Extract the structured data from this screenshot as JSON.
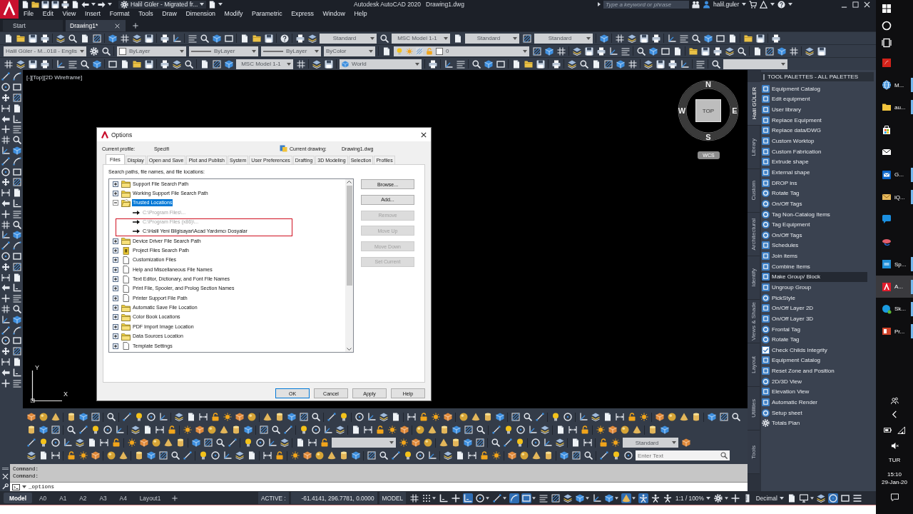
{
  "app_bar": {
    "workspace": "Halil Güler - Migrated fr...",
    "app_name": "Autodesk AutoCAD 2020",
    "file_name": "Drawing1.dwg",
    "search": {
      "placeholder": "Type a keyword or phrase"
    },
    "user": "halil.guler"
  },
  "menu": [
    "File",
    "Edit",
    "View",
    "Insert",
    "Format",
    "Tools",
    "Draw",
    "Dimension",
    "Modify",
    "Parametric",
    "Express",
    "Window",
    "Help"
  ],
  "doc_tabs": [
    {
      "label": "Start",
      "selected": false
    },
    {
      "label": "Drawing1*",
      "selected": true
    }
  ],
  "toolbars": {
    "row_1": {
      "dropdowns": [
        {
          "value": "Standard"
        },
        {
          "value": "MSC Model 1-1"
        },
        {
          "value": "Standard"
        },
        {
          "value": "Standard"
        }
      ]
    },
    "row_2": {
      "dropdowns": [
        {
          "value": "Halil Güler - M...018 - Englis"
        },
        {
          "value": "ByLayer"
        },
        {
          "value": "ByLayer"
        },
        {
          "value": "ByLayer"
        },
        {
          "value": "ByColor"
        },
        {
          "value": "0"
        }
      ]
    },
    "row_3": {
      "dropdowns": [
        {
          "value": "MSC Model 1-1"
        },
        {
          "value": "World"
        }
      ]
    },
    "bottom_row_3": {
      "dropdowns": [
        {
          "value": "Standard"
        }
      ]
    },
    "bottom_row_4": {
      "search": {
        "placeholder": "Enter Text"
      }
    }
  },
  "viewport": {
    "label": "[-][Top][2D Wireframe]",
    "viewcube": {
      "north": "N",
      "east": "E",
      "south": "S",
      "west": "W",
      "face": "TOP",
      "ucs": "WCS"
    },
    "ucs_icon": {
      "y_axis": "Y",
      "x_axis": "X"
    }
  },
  "options_dialog": {
    "title": "Options",
    "profile_label": "Current profile:",
    "profile": "Specifi",
    "drawing_label": "Current drawing:",
    "drawing": "Drawing1.dwg",
    "tabs": [
      {
        "label": "Files",
        "selected": true
      },
      {
        "label": "Display",
        "selected": false
      },
      {
        "label": "Open and Save",
        "selected": false
      },
      {
        "label": "Plot and Publish",
        "selected": false
      },
      {
        "label": "System",
        "selected": false
      },
      {
        "label": "User Preferences",
        "selected": false
      },
      {
        "label": "Drafting",
        "selected": false
      },
      {
        "label": "3D Modeling",
        "selected": false
      },
      {
        "label": "Selection",
        "selected": false
      },
      {
        "label": "Profiles",
        "selected": false
      }
    ],
    "list_label": "Search paths, file names, and file locations:",
    "tree": [
      {
        "label": "Support File Search Path",
        "kind": "folder",
        "expanded": false,
        "selected": false
      },
      {
        "label": "Working Support File Search Path",
        "kind": "folder",
        "expanded": false,
        "selected": false
      },
      {
        "label": "Trusted Locations",
        "kind": "folder",
        "expanded": true,
        "selected": true,
        "children": [
          {
            "label": "C:\\Program Files\\...",
            "disabled": true,
            "selected": false
          },
          {
            "label": "C:\\Program Files (x86)\\...",
            "disabled": true,
            "selected": false
          },
          {
            "label": "C:\\Halil Yeni Bilgisayar\\Acad Yardımcı Dosyalar",
            "disabled": false,
            "selected": false
          }
        ]
      },
      {
        "label": "Device Driver File Search Path",
        "kind": "folder",
        "expanded": false,
        "selected": false
      },
      {
        "label": "Project Files Search Path",
        "kind": "project",
        "expanded": false,
        "selected": false
      },
      {
        "label": "Customization Files",
        "kind": "file",
        "expanded": false,
        "selected": false
      },
      {
        "label": "Help and Miscellaneous File Names",
        "kind": "file",
        "expanded": false,
        "selected": false
      },
      {
        "label": "Text Editor, Dictionary, and Font File Names",
        "kind": "file",
        "expanded": false,
        "selected": false
      },
      {
        "label": "Print File, Spooler, and Prolog Section Names",
        "kind": "file",
        "expanded": false,
        "selected": false
      },
      {
        "label": "Printer Support File Path",
        "kind": "file",
        "expanded": false,
        "selected": false
      },
      {
        "label": "Automatic Save File Location",
        "kind": "folder",
        "expanded": false,
        "selected": false
      },
      {
        "label": "Color Book Locations",
        "kind": "folder",
        "expanded": false,
        "selected": false
      },
      {
        "label": "PDF Import Image Location",
        "kind": "folder",
        "expanded": false,
        "selected": false
      },
      {
        "label": "Data Sources Location",
        "kind": "folder",
        "expanded": false,
        "selected": false
      },
      {
        "label": "Template Settings",
        "kind": "file",
        "expanded": false,
        "selected": false
      }
    ],
    "side_buttons": [
      {
        "label": "Browse...",
        "disabled": false
      },
      {
        "label": "Add...",
        "disabled": false
      },
      {
        "label": "Remove",
        "disabled": true
      },
      {
        "label": "Move Up",
        "disabled": true
      },
      {
        "label": "Move Down",
        "disabled": true
      },
      {
        "label": "Set Current",
        "disabled": true
      }
    ],
    "footer_buttons": [
      {
        "label": "OK",
        "default": true
      },
      {
        "label": "Cancel",
        "default": false
      },
      {
        "label": "Apply",
        "default": false
      },
      {
        "label": "Help",
        "default": false
      }
    ]
  },
  "tool_palette": {
    "title": "TOOL PALETTES - ALL PALETTES",
    "tabs": [
      {
        "label": "Halil GÜLER",
        "selected": true
      },
      {
        "label": "Library",
        "selected": false
      },
      {
        "label": "Custom",
        "selected": false
      },
      {
        "label": "Architectural",
        "selected": false
      },
      {
        "label": "Identify",
        "selected": false
      },
      {
        "label": "Views & Shade",
        "selected": false
      },
      {
        "label": "Layout",
        "selected": false
      },
      {
        "label": "Utilities",
        "selected": false
      },
      {
        "label": "Tools",
        "selected": false
      }
    ],
    "items": [
      {
        "label": "Equipment Catalog",
        "selected": false
      },
      {
        "label": "Edit equipment",
        "selected": false
      },
      {
        "label": "User library",
        "selected": false
      },
      {
        "label": "Replace Equipment",
        "selected": false
      },
      {
        "label": "Replace data/DWG",
        "selected": false
      },
      {
        "label": "Custom Worktop",
        "selected": false
      },
      {
        "label": "Custom Fabrication",
        "selected": false
      },
      {
        "label": "Extrude shape",
        "selected": false
      },
      {
        "label": "External shape",
        "selected": false
      },
      {
        "label": "DROP ins",
        "selected": false
      },
      {
        "label": "Rotate Tag",
        "selected": false
      },
      {
        "label": "On/Off Tags",
        "selected": false
      },
      {
        "label": "Tag Non-Catalog Items",
        "selected": false
      },
      {
        "label": "Tag Equipment",
        "selected": false
      },
      {
        "label": "On/Off Tags",
        "selected": false
      },
      {
        "label": "Schedules",
        "selected": false
      },
      {
        "label": "Join items",
        "selected": false
      },
      {
        "label": "Combine Items",
        "selected": false
      },
      {
        "label": "Make Group/ Block",
        "selected": true
      },
      {
        "label": "Ungroup Group",
        "selected": false
      },
      {
        "label": "PickStyle",
        "selected": false
      },
      {
        "label": "On/Off Layer 2D",
        "selected": false
      },
      {
        "label": "On/Off Layer 3D",
        "selected": false
      },
      {
        "label": "Frontal Tag",
        "selected": false
      },
      {
        "label": "Rotate Tag",
        "selected": false
      },
      {
        "label": "Check Childs Integrity",
        "selected": false
      },
      {
        "label": "Equipment Catalog",
        "selected": false
      },
      {
        "label": "Reset Zone and Position",
        "selected": false
      },
      {
        "label": "2D/3D View",
        "selected": false
      },
      {
        "label": "Elevation View",
        "selected": false
      },
      {
        "label": "Automatic Render",
        "selected": false
      },
      {
        "label": "Setup sheet",
        "selected": false
      },
      {
        "label": "Totals Plan",
        "selected": false
      }
    ]
  },
  "command_line": {
    "history": [
      "Command:",
      "Command:"
    ],
    "value": "_options"
  },
  "status_bar": {
    "layout_tabs": [
      {
        "label": "Model",
        "selected": true
      },
      {
        "label": "A0",
        "selected": false
      },
      {
        "label": "A1",
        "selected": false
      },
      {
        "label": "A2",
        "selected": false
      },
      {
        "label": "A3",
        "selected": false
      },
      {
        "label": "A4",
        "selected": false
      },
      {
        "label": "Layout1",
        "selected": false
      }
    ],
    "coords_label": "ACTIVE :",
    "coords": "-61.4141, 296.7781, 0.0000",
    "space": "MODEL",
    "toggles": [
      {
        "on": false,
        "dropdown": false
      },
      {
        "on": false,
        "dropdown": true
      },
      {
        "on": false,
        "dropdown": false
      },
      {
        "on": false,
        "dropdown": false
      },
      {
        "on": true,
        "dropdown": false
      },
      {
        "on": false,
        "dropdown": true
      },
      {
        "on": false,
        "dropdown": true
      },
      {
        "on": true,
        "dropdown": false
      },
      {
        "on": true,
        "dropdown": true
      },
      {
        "on": false,
        "dropdown": false
      },
      {
        "on": false,
        "dropdown": false
      },
      {
        "on": false,
        "dropdown": false
      },
      {
        "on": false,
        "dropdown": true
      },
      {
        "on": false,
        "dropdown": false
      },
      {
        "on": false,
        "dropdown": true
      },
      {
        "on": true,
        "dropdown": true
      },
      {
        "on": true,
        "dropdown": false
      },
      {
        "on": false,
        "dropdown": false
      },
      {
        "on": false,
        "dropdown": false
      }
    ],
    "scale": "1:1 / 100%",
    "toggles_2": [
      {
        "on": false,
        "dropdown": true
      },
      {
        "on": false,
        "dropdown": false
      },
      {
        "on": false,
        "dropdown": false
      }
    ],
    "units": "Decimal",
    "toggles_3": [
      {
        "on": false,
        "dropdown": false
      },
      {
        "on": false,
        "dropdown": true
      },
      {
        "on": false,
        "dropdown": false
      },
      {
        "on": true,
        "dropdown": false
      },
      {
        "on": false,
        "dropdown": false
      },
      {
        "on": false,
        "dropdown": false
      }
    ]
  },
  "taskbar": {
    "apps": [
      {
        "kind": "start",
        "open": false,
        "selected": false
      },
      {
        "kind": "search",
        "open": false,
        "selected": false
      },
      {
        "kind": "task-view",
        "open": false,
        "selected": false
      },
      {
        "kind": "pdf",
        "open": false,
        "selected": false
      },
      {
        "kind": "browser",
        "label": "M...",
        "open": true,
        "selected": false
      },
      {
        "kind": "folder",
        "label": "au...",
        "open": true,
        "selected": false
      },
      {
        "kind": "store",
        "open": false,
        "selected": false
      },
      {
        "kind": "mail",
        "open": false,
        "selected": false
      },
      {
        "kind": "outlook",
        "label": "G...",
        "open": true,
        "selected": false
      },
      {
        "kind": "envelope",
        "label": "iQ...",
        "open": true,
        "selected": false
      },
      {
        "kind": "chat",
        "open": false,
        "selected": false
      },
      {
        "kind": "bird",
        "open": false,
        "selected": false
      },
      {
        "kind": "sp",
        "label": "Sp...",
        "open": true,
        "selected": false
      },
      {
        "kind": "cad",
        "label": "A...",
        "open": true,
        "selected": true
      },
      {
        "kind": "skype",
        "label": "Sk...",
        "open": true,
        "selected": false
      },
      {
        "kind": "slides",
        "label": "Pr...",
        "open": true,
        "selected": false
      }
    ],
    "tray": {
      "language": "TUR",
      "time": "15:10",
      "date": "29-Jan-20"
    }
  }
}
